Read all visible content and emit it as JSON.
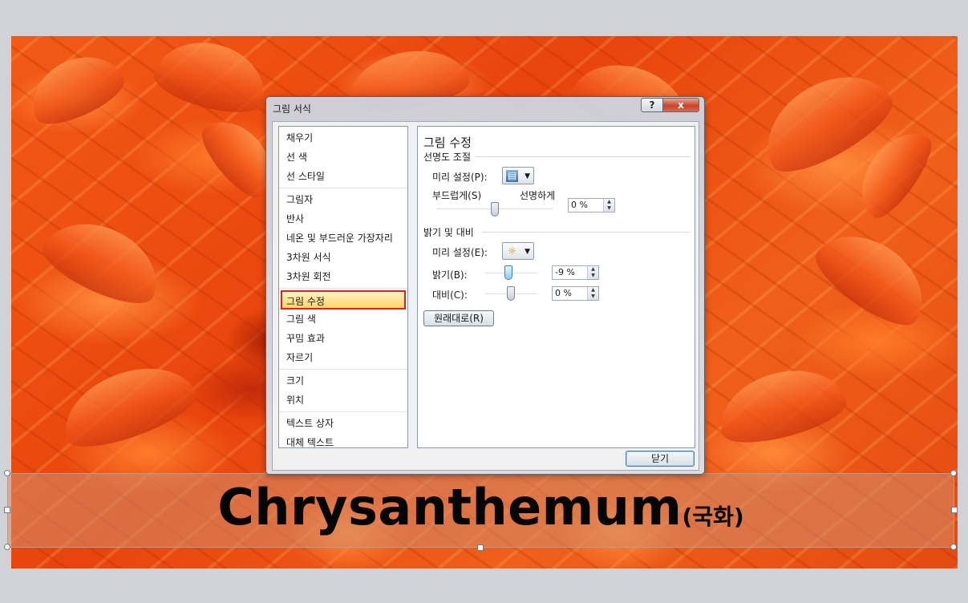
{
  "dialog": {
    "title": "그림 서식",
    "help_label": "?",
    "close_label": "x",
    "close_button_label": "닫기"
  },
  "nav": {
    "groups": [
      [
        "채우기",
        "선 색",
        "선 스타일"
      ],
      [
        "그림자",
        "반사",
        "네온 및 부드러운 가장자리",
        "3차원 서식",
        "3차원 회전"
      ],
      [
        "그림 수정",
        "그림 색",
        "꾸밈 효과",
        "자르기"
      ],
      [
        "크기",
        "위치"
      ],
      [
        "텍스트 상자",
        "대체 텍스트"
      ]
    ],
    "selected": "그림 수정"
  },
  "panel": {
    "heading": "그림 수정",
    "sharpness": {
      "section_label": "선명도 조절",
      "preset_label": "미리 설정(P):",
      "soften_label": "부드럽게(S)",
      "sharpen_label": "선명하게",
      "value": "0 %",
      "slider_level": 0
    },
    "brightness": {
      "section_label": "밝기 및 대비",
      "preset_label": "미리 설정(E):",
      "brightness_label": "밝기(B):",
      "brightness_value": "-9 %",
      "brightness_level": -9,
      "contrast_label": "대비(C):",
      "contrast_value": "0 %",
      "contrast_level": 0
    },
    "reset_label": "원래대로(R)"
  },
  "slide": {
    "caption_main": "Chrysanthemum",
    "caption_sub": "(국화)"
  },
  "icons": {
    "spin_up": "▲",
    "spin_down": "▼",
    "dropdown": "▼"
  },
  "colors": {
    "selection_border": "#e02020",
    "selection_fill": "#ffd667",
    "slide_base": "#e8440c"
  }
}
